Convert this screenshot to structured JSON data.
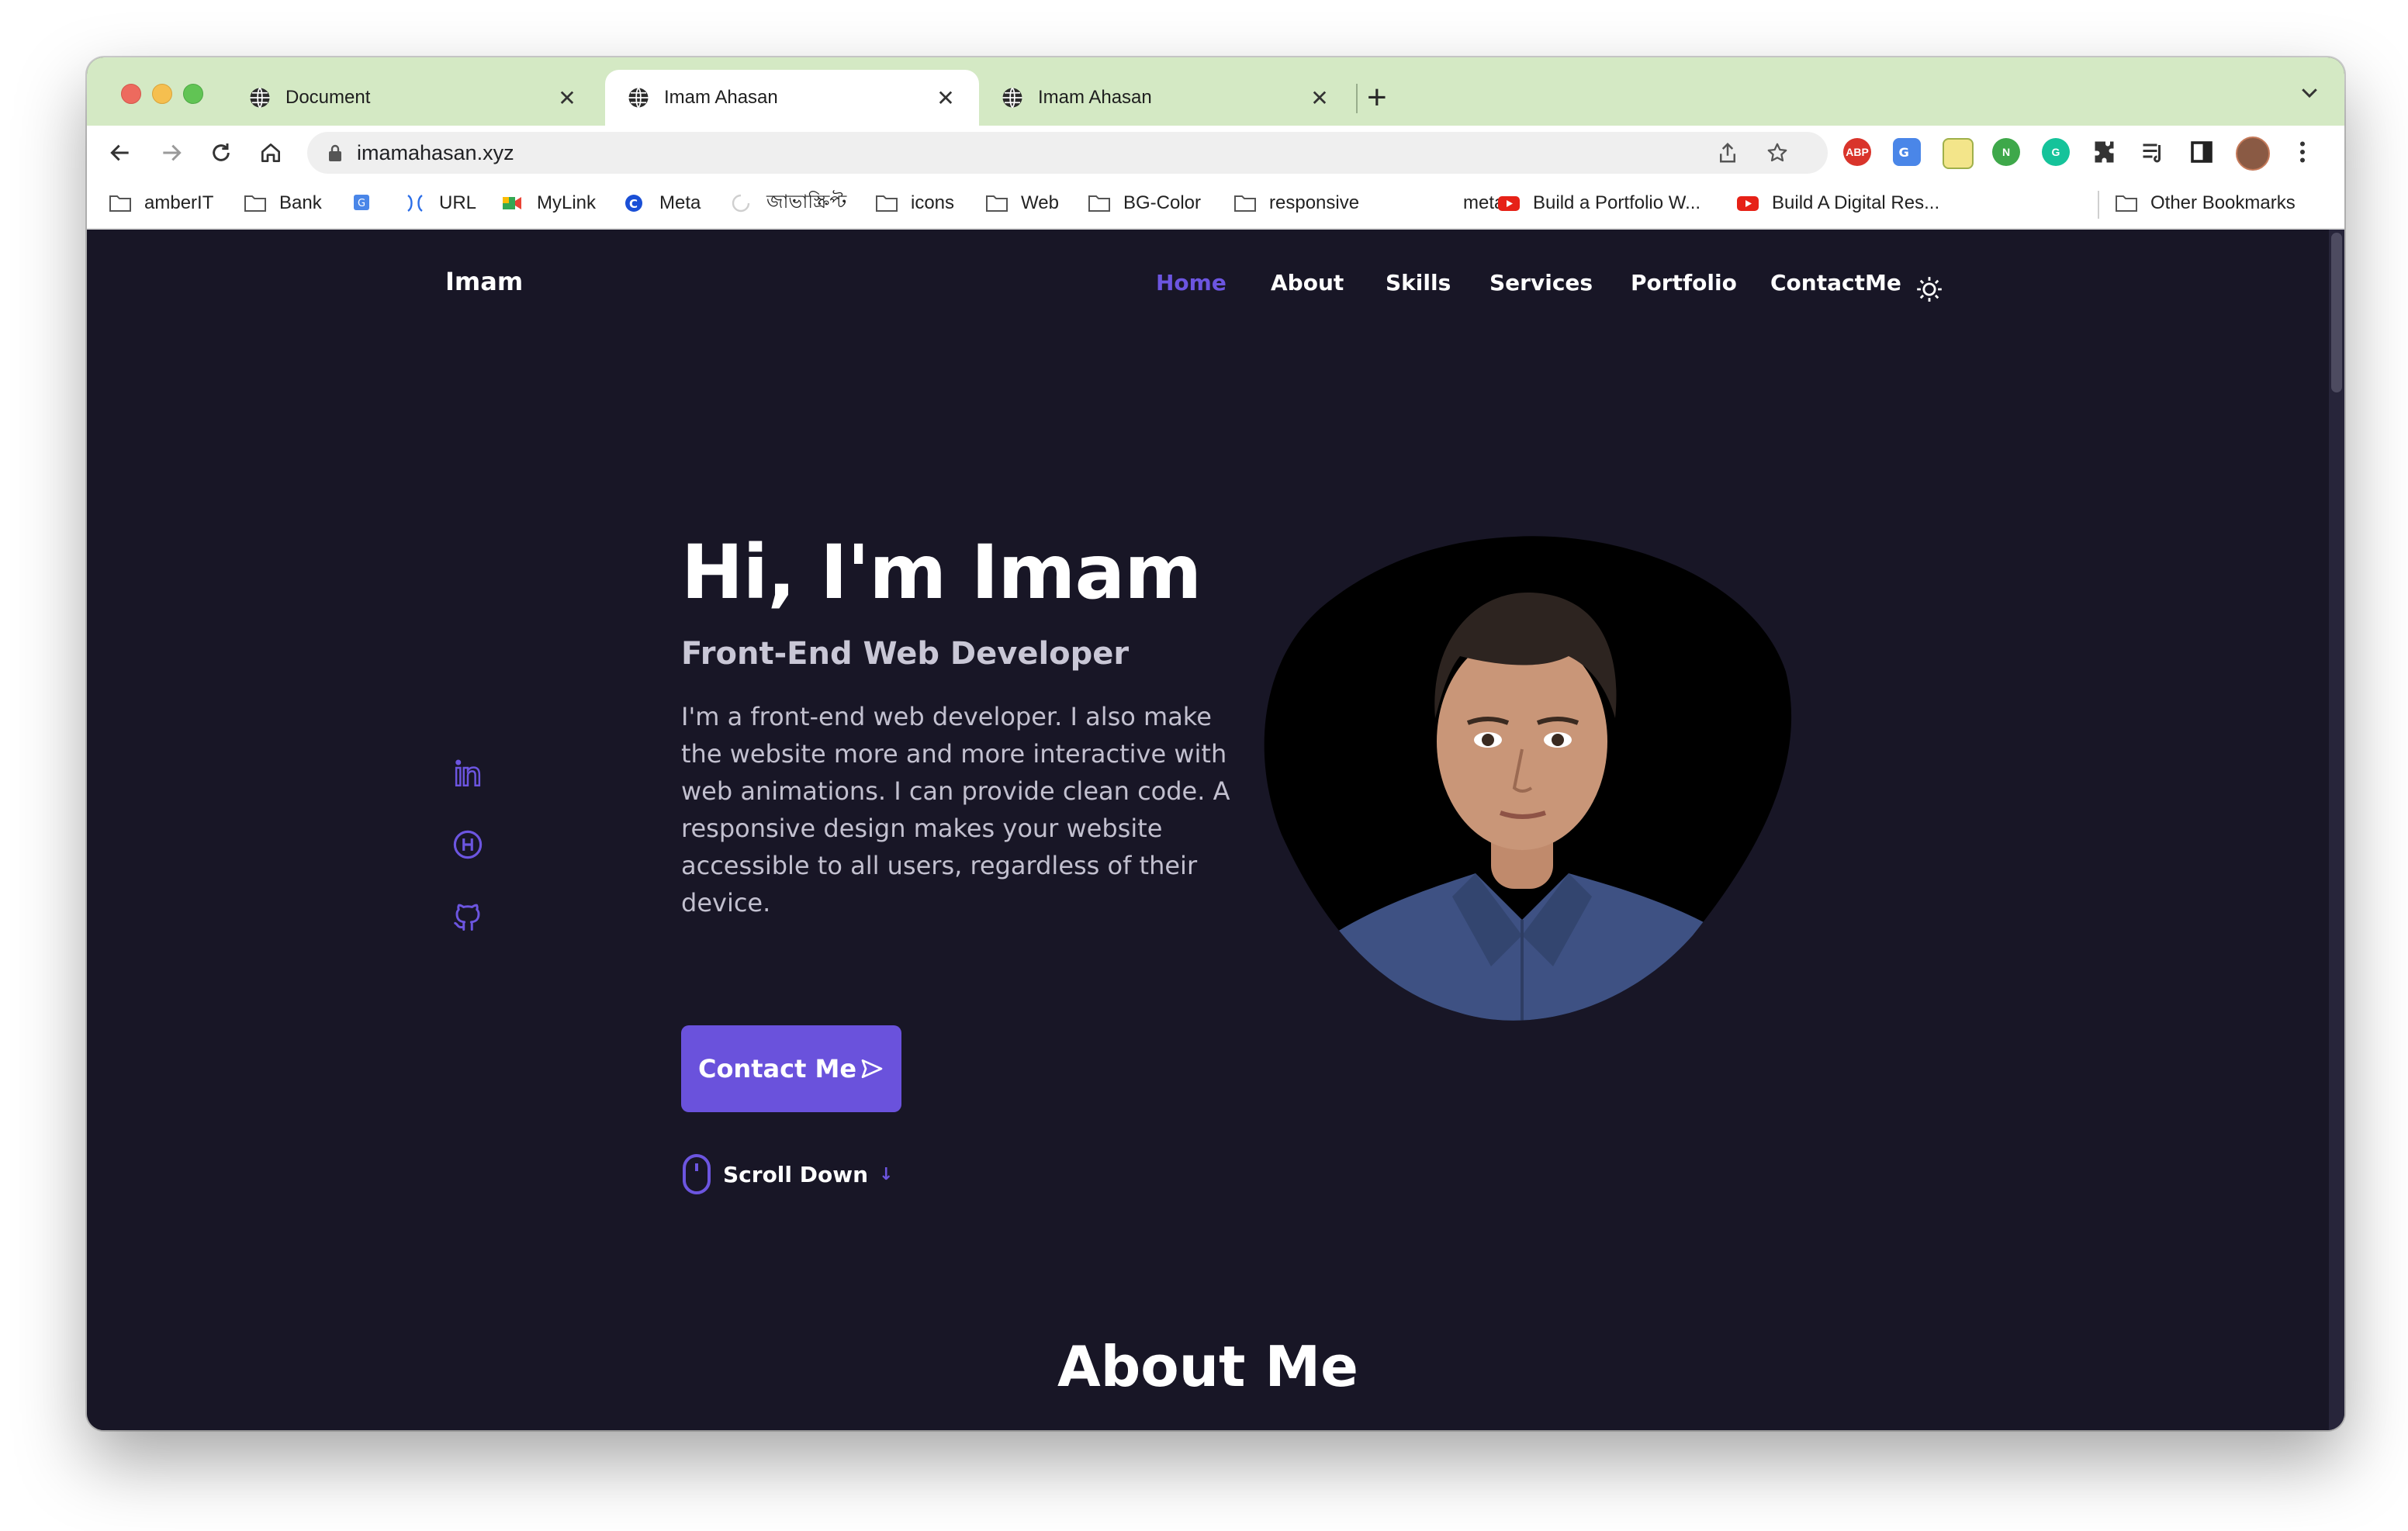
{
  "browser": {
    "tabs": [
      {
        "title": "Document",
        "active": false
      },
      {
        "title": "Imam Ahasan",
        "active": true
      },
      {
        "title": "Imam Ahasan",
        "active": false
      }
    ],
    "new_tab_symbol": "+",
    "url": "imamahasan.xyz",
    "bookmarks": [
      {
        "label": "amberIT",
        "icon": "folder-icon"
      },
      {
        "label": "Bank",
        "icon": "folder-icon"
      },
      {
        "label": "",
        "icon": "google-translate-icon"
      },
      {
        "label": "URL",
        "icon": "url-icon"
      },
      {
        "label": "MyLink",
        "icon": "meet-icon"
      },
      {
        "label": "Meta",
        "icon": "meta-icon"
      },
      {
        "label": "জাভাস্ক্রিপ্ট",
        "icon": "loading-icon"
      },
      {
        "label": "icons",
        "icon": "folder-icon"
      },
      {
        "label": "Web",
        "icon": "folder-icon"
      },
      {
        "label": "BG-Color",
        "icon": "folder-icon"
      },
      {
        "label": "responsive",
        "icon": "folder-icon"
      },
      {
        "label": "meta",
        "icon": "blank-icon"
      },
      {
        "label": "Build a Portfolio W...",
        "icon": "youtube-icon"
      },
      {
        "label": "Build A Digital Res...",
        "icon": "youtube-icon"
      },
      {
        "label": "Other Bookmarks",
        "icon": "folder-icon"
      }
    ],
    "extensions": [
      "adblock-plus-icon",
      "google-translate-icon",
      "notes-icon",
      "n-extension-icon",
      "grammarly-icon",
      "puzzle-icon",
      "reading-list-icon",
      "side-panel-icon",
      "profile-avatar",
      "more-menu-icon"
    ],
    "extension_labels": {
      "adblock": "ABP",
      "n_ext": "N",
      "grammarly": "G"
    }
  },
  "site": {
    "logo": "Imam",
    "nav": {
      "home": "Home",
      "about": "About",
      "skills": "Skills",
      "services": "Services",
      "portfolio": "Portfolio",
      "contact": "ContactMe"
    },
    "hero": {
      "title": "Hi, I'm Imam",
      "subtitle": "Front-End Web Developer",
      "description": "I'm a front-end web developer. I also make the website more and more interactive with web animations. I can provide clean code. A responsive design makes your website accessible to all users, regardless of their device.",
      "contact_button": "Contact Me",
      "scroll_down": "Scroll Down"
    },
    "social": [
      "linkedin-icon",
      "hashnode-icon",
      "github-icon"
    ],
    "about_title": "About Me",
    "colors": {
      "accent": "#6a52dc",
      "background": "#181626"
    }
  }
}
